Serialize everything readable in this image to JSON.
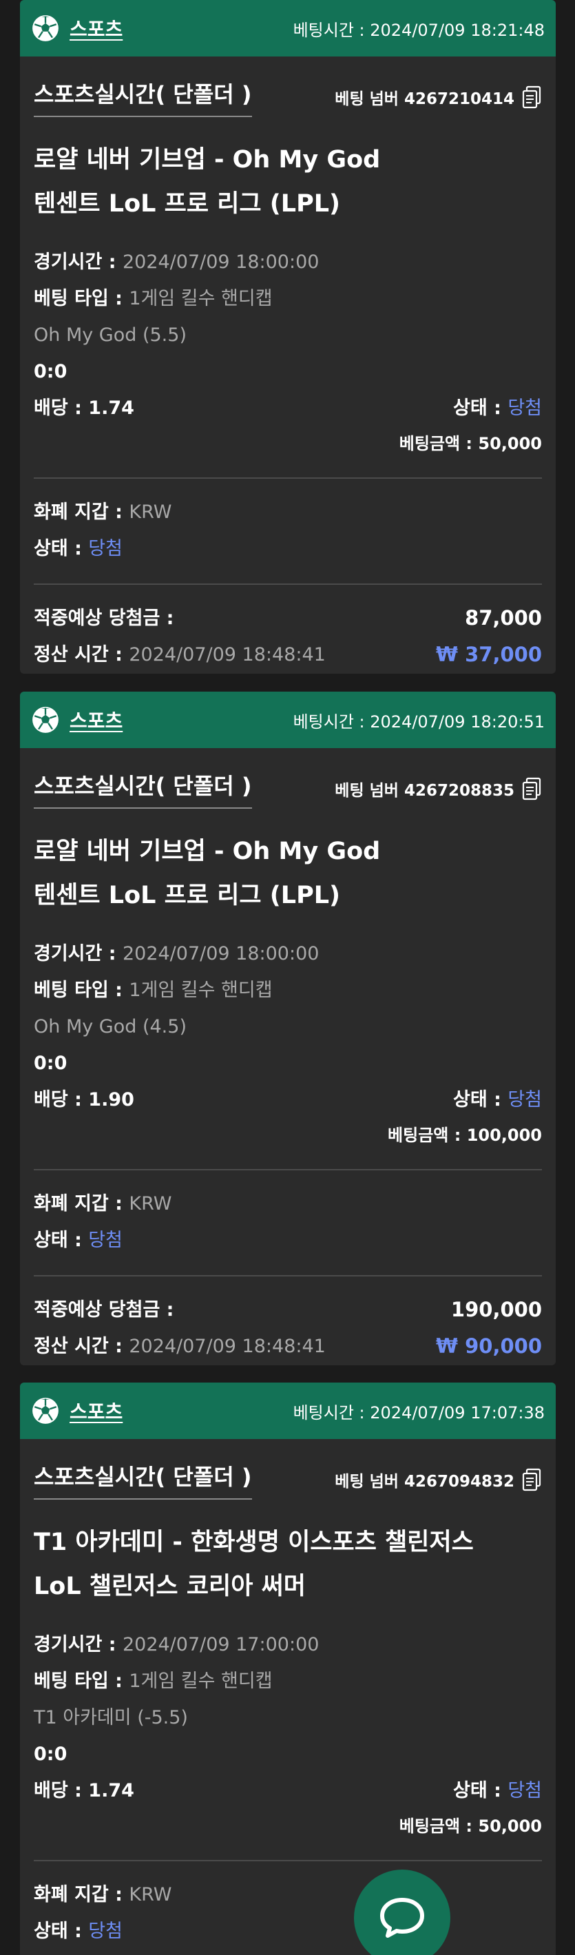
{
  "cards": [
    {
      "sport": "스포츠",
      "bet_time_label": "베팅시간 : ",
      "bet_time": "2024/07/09 18:21:48",
      "title": "스포츠실시간( 단폴더 )",
      "bet_number_label": "베팅 넘버 ",
      "bet_number": "4267210414",
      "match": "로얄 네버 기브업 - Oh My God",
      "league": "텐센트 LoL 프로 리그 (LPL)",
      "game_time_label": "경기시간 : ",
      "game_time": "2024/07/09 18:00:00",
      "bet_type_label": "베팅 타입 : ",
      "bet_type": "1게임 킬수 핸디캡",
      "pick": "Oh My God (5.5)",
      "score": "0:0",
      "odds_label": "배당 : ",
      "odds": "1.74",
      "status_label": "상태 : ",
      "status": "당첨",
      "amount_label": "베팅금액 : ",
      "amount": "50,000",
      "currency_label": "화폐 지갑 : ",
      "currency": "KRW",
      "status2_label": "상태 : ",
      "status2": "당첨",
      "expected_label": "적중예상 당첨금 :",
      "expected": "87,000",
      "settle_label": "정산 시간 : ",
      "settle_time": "2024/07/09 18:48:41",
      "profit": "₩ 37,000"
    },
    {
      "sport": "스포츠",
      "bet_time_label": "베팅시간 : ",
      "bet_time": "2024/07/09 18:20:51",
      "title": "스포츠실시간( 단폴더 )",
      "bet_number_label": "베팅 넘버 ",
      "bet_number": "4267208835",
      "match": "로얄 네버 기브업 - Oh My God",
      "league": "텐센트 LoL 프로 리그 (LPL)",
      "game_time_label": "경기시간 : ",
      "game_time": "2024/07/09 18:00:00",
      "bet_type_label": "베팅 타입 : ",
      "bet_type": "1게임 킬수 핸디캡",
      "pick": "Oh My God (4.5)",
      "score": "0:0",
      "odds_label": "배당 : ",
      "odds": "1.90",
      "status_label": "상태 : ",
      "status": "당첨",
      "amount_label": "베팅금액 : ",
      "amount": "100,000",
      "currency_label": "화폐 지갑 : ",
      "currency": "KRW",
      "status2_label": "상태 : ",
      "status2": "당첨",
      "expected_label": "적중예상 당첨금 :",
      "expected": "190,000",
      "settle_label": "정산 시간 : ",
      "settle_time": "2024/07/09 18:48:41",
      "profit": "₩ 90,000"
    },
    {
      "sport": "스포츠",
      "bet_time_label": "베팅시간 : ",
      "bet_time": "2024/07/09 17:07:38",
      "title": "스포츠실시간( 단폴더 )",
      "bet_number_label": "베팅 넘버 ",
      "bet_number": "4267094832",
      "match": "T1 아카데미 - 한화생명 이스포츠 챌린저스",
      "league": "LoL 챌린저스 코리아 써머",
      "game_time_label": "경기시간 : ",
      "game_time": "2024/07/09 17:00:00",
      "bet_type_label": "베팅 타입 : ",
      "bet_type": "1게임 킬수 핸디캡",
      "pick": "T1 아카데미 (-5.5)",
      "score": "0:0",
      "odds_label": "배당 : ",
      "odds": "1.74",
      "status_label": "상태 : ",
      "status": "당첨",
      "amount_label": "베팅금액 : ",
      "amount": "50,000",
      "currency_label": "화폐 지갑 : ",
      "currency": "KRW",
      "status2_label": "상태 : ",
      "status2": "당첨"
    }
  ],
  "colors": {
    "header_green": "#137256",
    "card_bg": "#2b2b2b",
    "page_bg": "#1b1b1b",
    "accent_blue": "#6e8ef5",
    "muted_text": "#a9a9a9"
  },
  "icons": {
    "sport": "soccer-ball-icon",
    "copy": "copy-document-icon",
    "chat": "chat-bubble-icon"
  }
}
